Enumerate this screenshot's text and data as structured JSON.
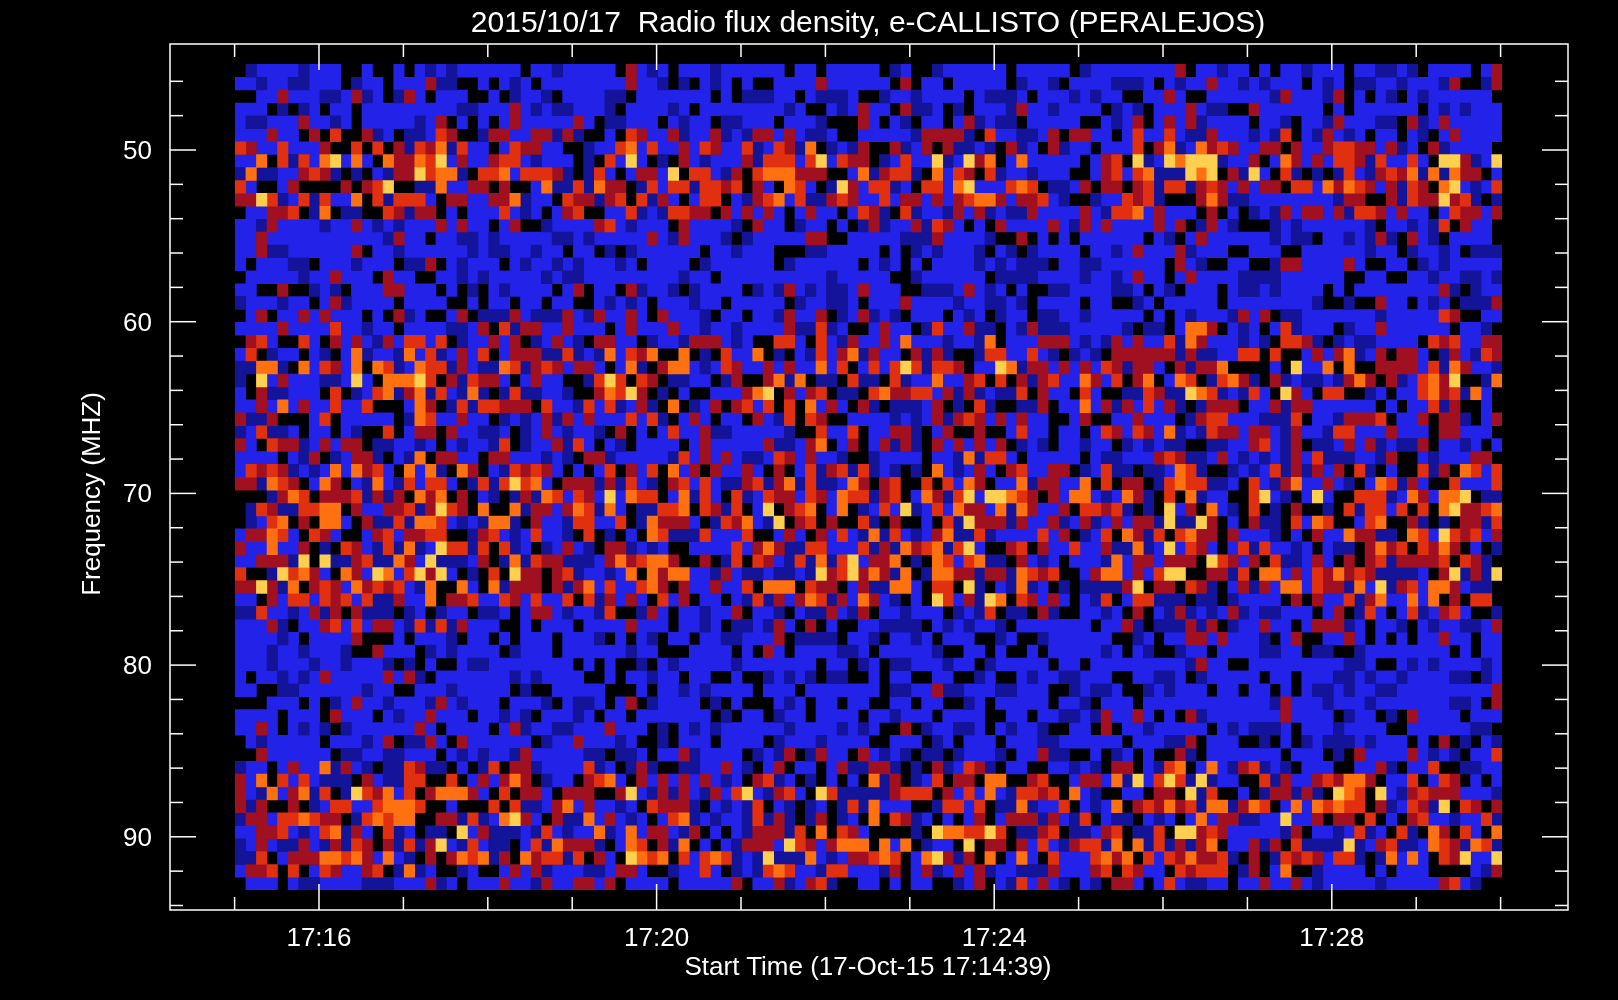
{
  "title": "2015/10/17  Radio flux density, e-CALLISTO (PERALEJOS)",
  "y_axis": {
    "label": "Frequency (MHZ)",
    "ticks": [
      "50",
      "60",
      "70",
      "80",
      "90"
    ]
  },
  "x_axis": {
    "label": "Start Time (17-Oct-15 17:14:39)",
    "ticks": [
      "17:16",
      "17:20",
      "17:24",
      "17:28"
    ]
  }
}
